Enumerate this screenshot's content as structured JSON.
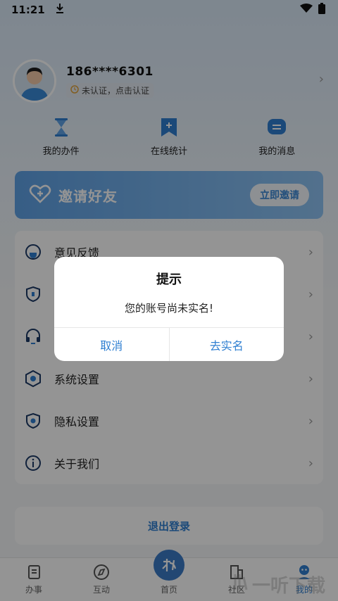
{
  "status_bar": {
    "time": "11:21"
  },
  "profile": {
    "phone": "186****6301",
    "verify_text": "未认证，点击认证"
  },
  "quick_actions": [
    {
      "label": "我的办件",
      "icon": "hourglass-icon"
    },
    {
      "label": "在线统计",
      "icon": "bookmark-plus-icon"
    },
    {
      "label": "我的消息",
      "icon": "message-icon"
    }
  ],
  "invite": {
    "title": "邀请好友",
    "button": "立即邀请"
  },
  "menu": [
    {
      "label": "意见反馈",
      "icon": "feedback-icon"
    },
    {
      "label": "",
      "icon": "shield-lock-icon"
    },
    {
      "label": "",
      "icon": "headset-icon"
    },
    {
      "label": "系统设置",
      "icon": "settings-icon"
    },
    {
      "label": "隐私设置",
      "icon": "privacy-icon"
    },
    {
      "label": "关于我们",
      "icon": "info-icon"
    }
  ],
  "logout": "退出登录",
  "tabbar": [
    {
      "label": "办事",
      "icon": "affairs-icon"
    },
    {
      "label": "互动",
      "icon": "interact-icon"
    },
    {
      "label": "首页",
      "icon": "home-logo-icon"
    },
    {
      "label": "社区",
      "icon": "community-icon"
    },
    {
      "label": "我的",
      "icon": "mine-icon"
    }
  ],
  "dialog": {
    "title": "提示",
    "message": "您的账号尚未实名!",
    "cancel": "取消",
    "confirm": "去实名"
  },
  "watermark": "一听下载",
  "colors": {
    "accent": "#2f7fd1",
    "invite_bg": "#5fa2e6",
    "overlay": "rgba(0,0,0,0.42)"
  }
}
